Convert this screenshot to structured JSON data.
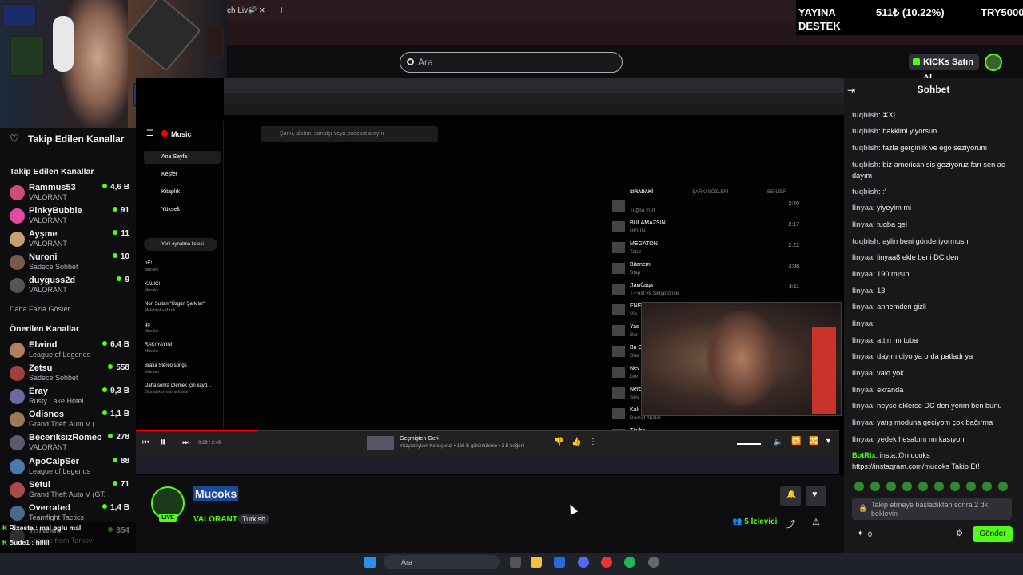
{
  "browser": {
    "tab_title": "ch Liv",
    "new_tab_symbol": "+"
  },
  "header": {
    "search_placeholder": "Ara",
    "kicks_label": "KICKs Satın Al"
  },
  "stats": {
    "label1": "YAYINA",
    "label2": "DESTEK",
    "amount": "511₺ (10.22%)",
    "goal": "TRY5000"
  },
  "sidebar": {
    "title": "Takip Edilen Kanallar",
    "followed_heading": "Takip Edilen Kanallar",
    "followed": [
      {
        "name": "Rammus53",
        "game": "VALORANT",
        "viewers": "4,6 B",
        "color": "#d04a7a"
      },
      {
        "name": "PinkyBubble",
        "game": "VALORANT",
        "viewers": "91",
        "color": "#e04aa0"
      },
      {
        "name": "Ayşme",
        "game": "VALORANT",
        "viewers": "11",
        "color": "#c8a070"
      },
      {
        "name": "Nuroni",
        "game": "Sadece Sohbet",
        "viewers": "10",
        "color": "#7a5a4a"
      },
      {
        "name": "duyguss2d",
        "game": "VALORANT",
        "viewers": "9",
        "color": "#555"
      }
    ],
    "show_more": "Daha Fazla Göster",
    "recommended_heading": "Önerilen Kanallar",
    "recommended": [
      {
        "name": "Elwind",
        "game": "League of Legends",
        "viewers": "6,4 B",
        "color": "#b08060"
      },
      {
        "name": "Zetsu",
        "game": "Sadece Sohbet",
        "viewers": "558",
        "color": "#a04040"
      },
      {
        "name": "Eray",
        "game": "Rusty Lake Hotel",
        "viewers": "9,3 B",
        "color": "#6a6aa0"
      },
      {
        "name": "Odisnos",
        "game": "Grand Theft Auto V (...",
        "viewers": "1,1 B",
        "color": "#9a7a5a"
      },
      {
        "name": "BeceriksizRomeo",
        "game": "VALORANT",
        "viewers": "278",
        "color": "#5a5a6a"
      },
      {
        "name": "ApoCalpSer",
        "game": "League of Legends",
        "viewers": "88",
        "color": "#4a7aaa"
      },
      {
        "name": "Setul",
        "game": "Grand Theft Auto V (GTA)",
        "viewers": "71",
        "color": "#aa4a4a"
      },
      {
        "name": "Overrated",
        "game": "Teamfight Tactics",
        "viewers": "1,4 B",
        "color": "#4a6a8a"
      },
      {
        "name": "Torwalk",
        "game": "Escape from Tarkov",
        "viewers": "354",
        "color": "#6a6a6a"
      }
    ]
  },
  "ytmusic": {
    "logo": "Music",
    "search_placeholder": "Şarkı, albüm, sanatçı veya podcast arayın",
    "nav": [
      "Ana Sayfa",
      "Keşfet",
      "Kitaplık",
      "Yükselt"
    ],
    "new_playlist": "Yeni oynatma listesi",
    "playlists": [
      {
        "title": "nE!",
        "sub": "Mucoks"
      },
      {
        "title": "KALICI",
        "sub": "Mucoks"
      },
      {
        "title": "Nun Sultan \"Üzgün Şarkılar\"",
        "sub": "Melankolia Müzik"
      },
      {
        "title": "gg",
        "sub": "Mucoks"
      },
      {
        "title": "RAKI YAYINI",
        "sub": "Mucoks"
      },
      {
        "title": "Bratia Stereo songs",
        "sub": "Valerian"
      },
      {
        "title": "Daha sonra izlemek için kayd...",
        "sub": "Otomatik oynatma listesi"
      }
    ],
    "queue_tabs": [
      "SIRADAKİ",
      "ŞARKI SÖZLERİ",
      "BENZER"
    ],
    "queue": [
      {
        "title": "",
        "artist": "Tuğba Yurt",
        "dur": "2:40"
      },
      {
        "title": "BULAMAZSIN",
        "artist": "HELİN",
        "dur": "2:17"
      },
      {
        "title": "MEGATON",
        "artist": "Tatar",
        "dur": "2:22"
      },
      {
        "title": "Bitanem",
        "artist": "Stap",
        "dur": "3:08"
      },
      {
        "title": "Ламбада",
        "artist": "T-Fest ve Skryptonite",
        "dur": "3:11"
      },
      {
        "title": "ENE",
        "artist": "Vie",
        "dur": ""
      },
      {
        "title": "Yas",
        "artist": "Ber",
        "dur": ""
      },
      {
        "title": "Bu C",
        "artist": "She",
        "dur": ""
      },
      {
        "title": "Nev",
        "artist": "Den",
        "dur": ""
      },
      {
        "title": "Nerd",
        "artist": "Ses",
        "dur": ""
      },
      {
        "title": "Kalı",
        "artist": "Demet Akalın",
        "dur": ""
      },
      {
        "title": "Tövbe",
        "artist": "",
        "dur": ""
      }
    ],
    "time": "0:29 / 2:49",
    "now_playing_title": "Geçmişten Geri",
    "now_playing_meta": "Yüzyüzeyken Konuşuruz • 166 B görüntüleme • 3 B beğeni",
    "progress": 0.172
  },
  "stream": {
    "streamer": "Mucoks",
    "live": "LIVE",
    "game": "VALORANT",
    "language": "Turkish",
    "viewer_count": "5",
    "viewer_label": "İzleyici"
  },
  "chat": {
    "title": "Sohbet",
    "messages": [
      {
        "user": "tuqbish",
        "text": "ⵣXI"
      },
      {
        "user": "tuqbish",
        "text": "hakkimi yiyorsun"
      },
      {
        "user": "tuqbish",
        "text": "fazla gerginlik ve ego seziyorum"
      },
      {
        "user": "tuqbish",
        "text": "biz american sis geziyoruz farı sen ac dayım"
      },
      {
        "user": "tuqbish",
        "text": ":'"
      },
      {
        "user": "linyaa",
        "text": "yiyeyim mi"
      },
      {
        "user": "linyaa",
        "text": "tugba gel"
      },
      {
        "user": "tuqbish",
        "text": "aylin beni gönderiyormusn"
      },
      {
        "user": "linyaa",
        "text": "linyaa8 ekle beni DC den"
      },
      {
        "user": "linyaa",
        "text": "190 mısın"
      },
      {
        "user": "linyaa",
        "text": "13"
      },
      {
        "user": "linyaa",
        "text": "annemden gizli"
      },
      {
        "user": "linyaa",
        "text": ""
      },
      {
        "user": "linyaa",
        "text": "attın mı tuba"
      },
      {
        "user": "linyaa",
        "text": "dayım diyo ya orda patladı ya"
      },
      {
        "user": "linyaa",
        "text": "valo yok"
      },
      {
        "user": "linyaa",
        "text": "ekranda"
      },
      {
        "user": "linyaa",
        "text": "neyse eklerse DC den yerim ben bunu"
      },
      {
        "user": "linyaa",
        "text": "yatış moduna geçiyom çok bağırma"
      },
      {
        "user": "linyaa",
        "text": "yedek hesabını mı kasıyon"
      },
      {
        "user": "BotRix",
        "text": "insta:@mucoks https://instagram.com/mucoks Takip Et!"
      }
    ],
    "input_placeholder": "Takip etmeye başladıktan sonra 2 dk bekleyin",
    "send_label": "Gönder",
    "points": "0"
  },
  "overlay_chat": [
    {
      "user": "Rixesta",
      "text": "mal oglu mal"
    },
    {
      "user": "Sude1",
      "text": "hiiiii"
    }
  ],
  "taskbar": {
    "search_placeholder": "Ara"
  }
}
